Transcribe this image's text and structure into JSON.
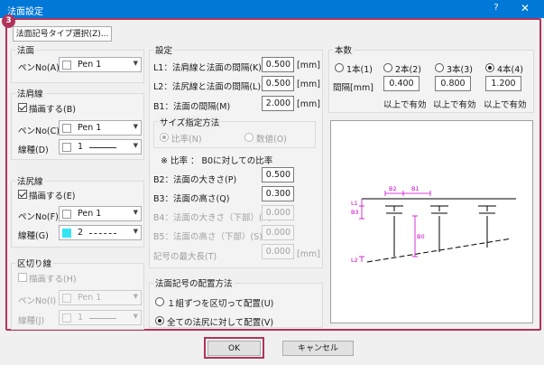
{
  "window": {
    "title": "法面設定",
    "help": "?",
    "close": "✕",
    "badge": "3"
  },
  "typeButton": "法面記号タイプ選択(Z)...",
  "houmen": {
    "title": "法面",
    "pen_label": "ペンNo(A)",
    "pen_value": "Pen 1"
  },
  "katagawa": {
    "title": "法肩線",
    "draw_label": "描画する(B)",
    "pen_label": "ペンNo(C)",
    "pen_value": "Pen 1",
    "line_label": "線種(D)",
    "line_value": "1"
  },
  "jiri": {
    "title": "法尻線",
    "draw_label": "描画する(E)",
    "pen_label": "ペンNo(F)",
    "pen_value": "Pen 1",
    "line_label": "線種(G)",
    "line_value": "2",
    "swatch_color": "#33e5f2"
  },
  "kugiri": {
    "title": "区切り線",
    "draw_label": "描画する(H)",
    "pen_label": "ペンNo(I)",
    "pen_value": "Pen 1",
    "line_label": "線種(J)",
    "line_value": "1"
  },
  "settings": {
    "title": "設定",
    "l1_label": "L1：法肩線と法面の間隔(K)",
    "l1_value": "0.500",
    "l1_unit": "[mm]",
    "l2_label": "L2：法尻線と法面の間隔(L)",
    "l2_value": "0.500",
    "l2_unit": "[mm]",
    "b1_label": "B1：法面の間隔(M)",
    "b1_value": "2.000",
    "b1_unit": "[mm]",
    "size_group": "サイズ指定方法",
    "ratio_label": "比率(N)",
    "numeric_label": "数値(O)",
    "note": "※ 比率 ： B0に対しての比率",
    "b2_label": "B2：法面の大きさ(P)",
    "b2_value": "0.500",
    "b3_label": "B3：法面の高さ(Q)",
    "b3_value": "0.300",
    "b4_label": "B4：法面の大きさ（下部）(R)",
    "b4_value": "0.000",
    "b5_label": "B5：法面の高さ（下部）(S)",
    "b5_value": "0.000",
    "max_label": "記号の最大長(T)",
    "max_value": "0.000",
    "max_unit": "[mm]"
  },
  "placement": {
    "title": "法面記号の配置方法",
    "opt1": "１組ずつを区切って配置(U)",
    "opt2": "全ての法尻に対して配置(V)"
  },
  "count": {
    "title": "本数",
    "r1": "1本(1)",
    "r2": "2本(2)",
    "r3": "3本(3)",
    "r4": "4本(4)",
    "interval_label": "間隔[mm]",
    "v2": "0.400",
    "v3": "0.800",
    "v4": "1.200",
    "valid": "以上で有効"
  },
  "preview": {
    "b2": "B2",
    "b1": "B1",
    "l1": "L1",
    "b3": "B3",
    "b0": "B0",
    "l2": "L2",
    "accent_color": "#cc00cc"
  },
  "buttons": {
    "ok": "OK",
    "cancel": "キャンセル"
  }
}
